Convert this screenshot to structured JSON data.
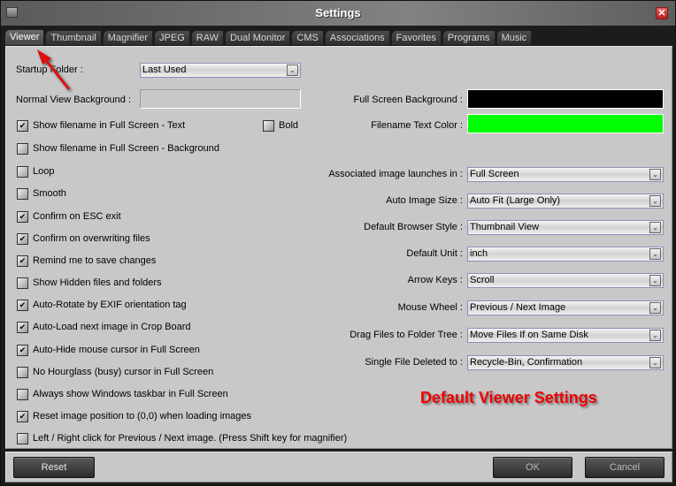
{
  "window": {
    "title": "Settings"
  },
  "tabs": [
    {
      "label": "Viewer",
      "active": true
    },
    {
      "label": "Thumbnail",
      "active": false
    },
    {
      "label": "Magnifier",
      "active": false
    },
    {
      "label": "JPEG",
      "active": false
    },
    {
      "label": "RAW",
      "active": false
    },
    {
      "label": "Dual Monitor",
      "active": false
    },
    {
      "label": "CMS",
      "active": false
    },
    {
      "label": "Associations",
      "active": false
    },
    {
      "label": "Favorites",
      "active": false
    },
    {
      "label": "Programs",
      "active": false
    },
    {
      "label": "Music",
      "active": false
    }
  ],
  "left": {
    "startup_folder": {
      "label": "Startup Folder :",
      "value": "Last Used"
    },
    "normal_view_bg": {
      "label": "Normal View Background :",
      "value": ""
    },
    "bold": {
      "label": "Bold",
      "checked": false
    },
    "checkboxes": [
      {
        "label": "Show filename in Full Screen - Text",
        "checked": true
      },
      {
        "label": "Show filename in Full Screen - Background",
        "checked": false
      },
      {
        "label": "Loop",
        "checked": false
      },
      {
        "label": "Smooth",
        "checked": false
      },
      {
        "label": "Confirm on ESC exit",
        "checked": true
      },
      {
        "label": "Confirm on overwriting files",
        "checked": true
      },
      {
        "label": "Remind me to save changes",
        "checked": true
      },
      {
        "label": "Show Hidden files and folders",
        "checked": false
      },
      {
        "label": "Auto-Rotate by EXIF orientation tag",
        "checked": true
      },
      {
        "label": "Auto-Load next image in Crop Board",
        "checked": true
      },
      {
        "label": "Auto-Hide mouse cursor in Full Screen",
        "checked": true
      },
      {
        "label": "No Hourglass (busy) cursor in Full Screen",
        "checked": false
      },
      {
        "label": "Always show Windows taskbar in Full Screen",
        "checked": false
      },
      {
        "label": "Reset image position to (0,0) when loading images",
        "checked": true
      },
      {
        "label": "Left / Right click for Previous / Next image. (Press Shift key for magnifier)",
        "checked": false
      }
    ]
  },
  "right": {
    "full_screen_bg": {
      "label": "Full Screen Background :",
      "color": "#000000"
    },
    "filename_text_color": {
      "label": "Filename Text Color :",
      "color": "#00ff00"
    },
    "selects": [
      {
        "label": "Associated image launches in :",
        "value": "Full Screen"
      },
      {
        "label": "Auto Image Size :",
        "value": "Auto Fit (Large Only)"
      },
      {
        "label": "Default Browser Style :",
        "value": "Thumbnail View"
      },
      {
        "label": "Default Unit :",
        "value": "inch"
      },
      {
        "label": "Arrow Keys :",
        "value": "Scroll"
      },
      {
        "label": "Mouse Wheel :",
        "value": "Previous / Next Image"
      },
      {
        "label": "Drag Files to Folder Tree :",
        "value": "Move Files If on Same Disk"
      },
      {
        "label": "Single File Deleted to :",
        "value": "Recycle-Bin, Confirmation"
      }
    ]
  },
  "annotation": {
    "text": "Default Viewer Settings",
    "color": "#ee0000"
  },
  "footer": {
    "reset": "Reset",
    "ok": "OK",
    "cancel": "Cancel"
  },
  "icons": {
    "close": "✕",
    "check": "✔",
    "dropdown": "⌄"
  }
}
